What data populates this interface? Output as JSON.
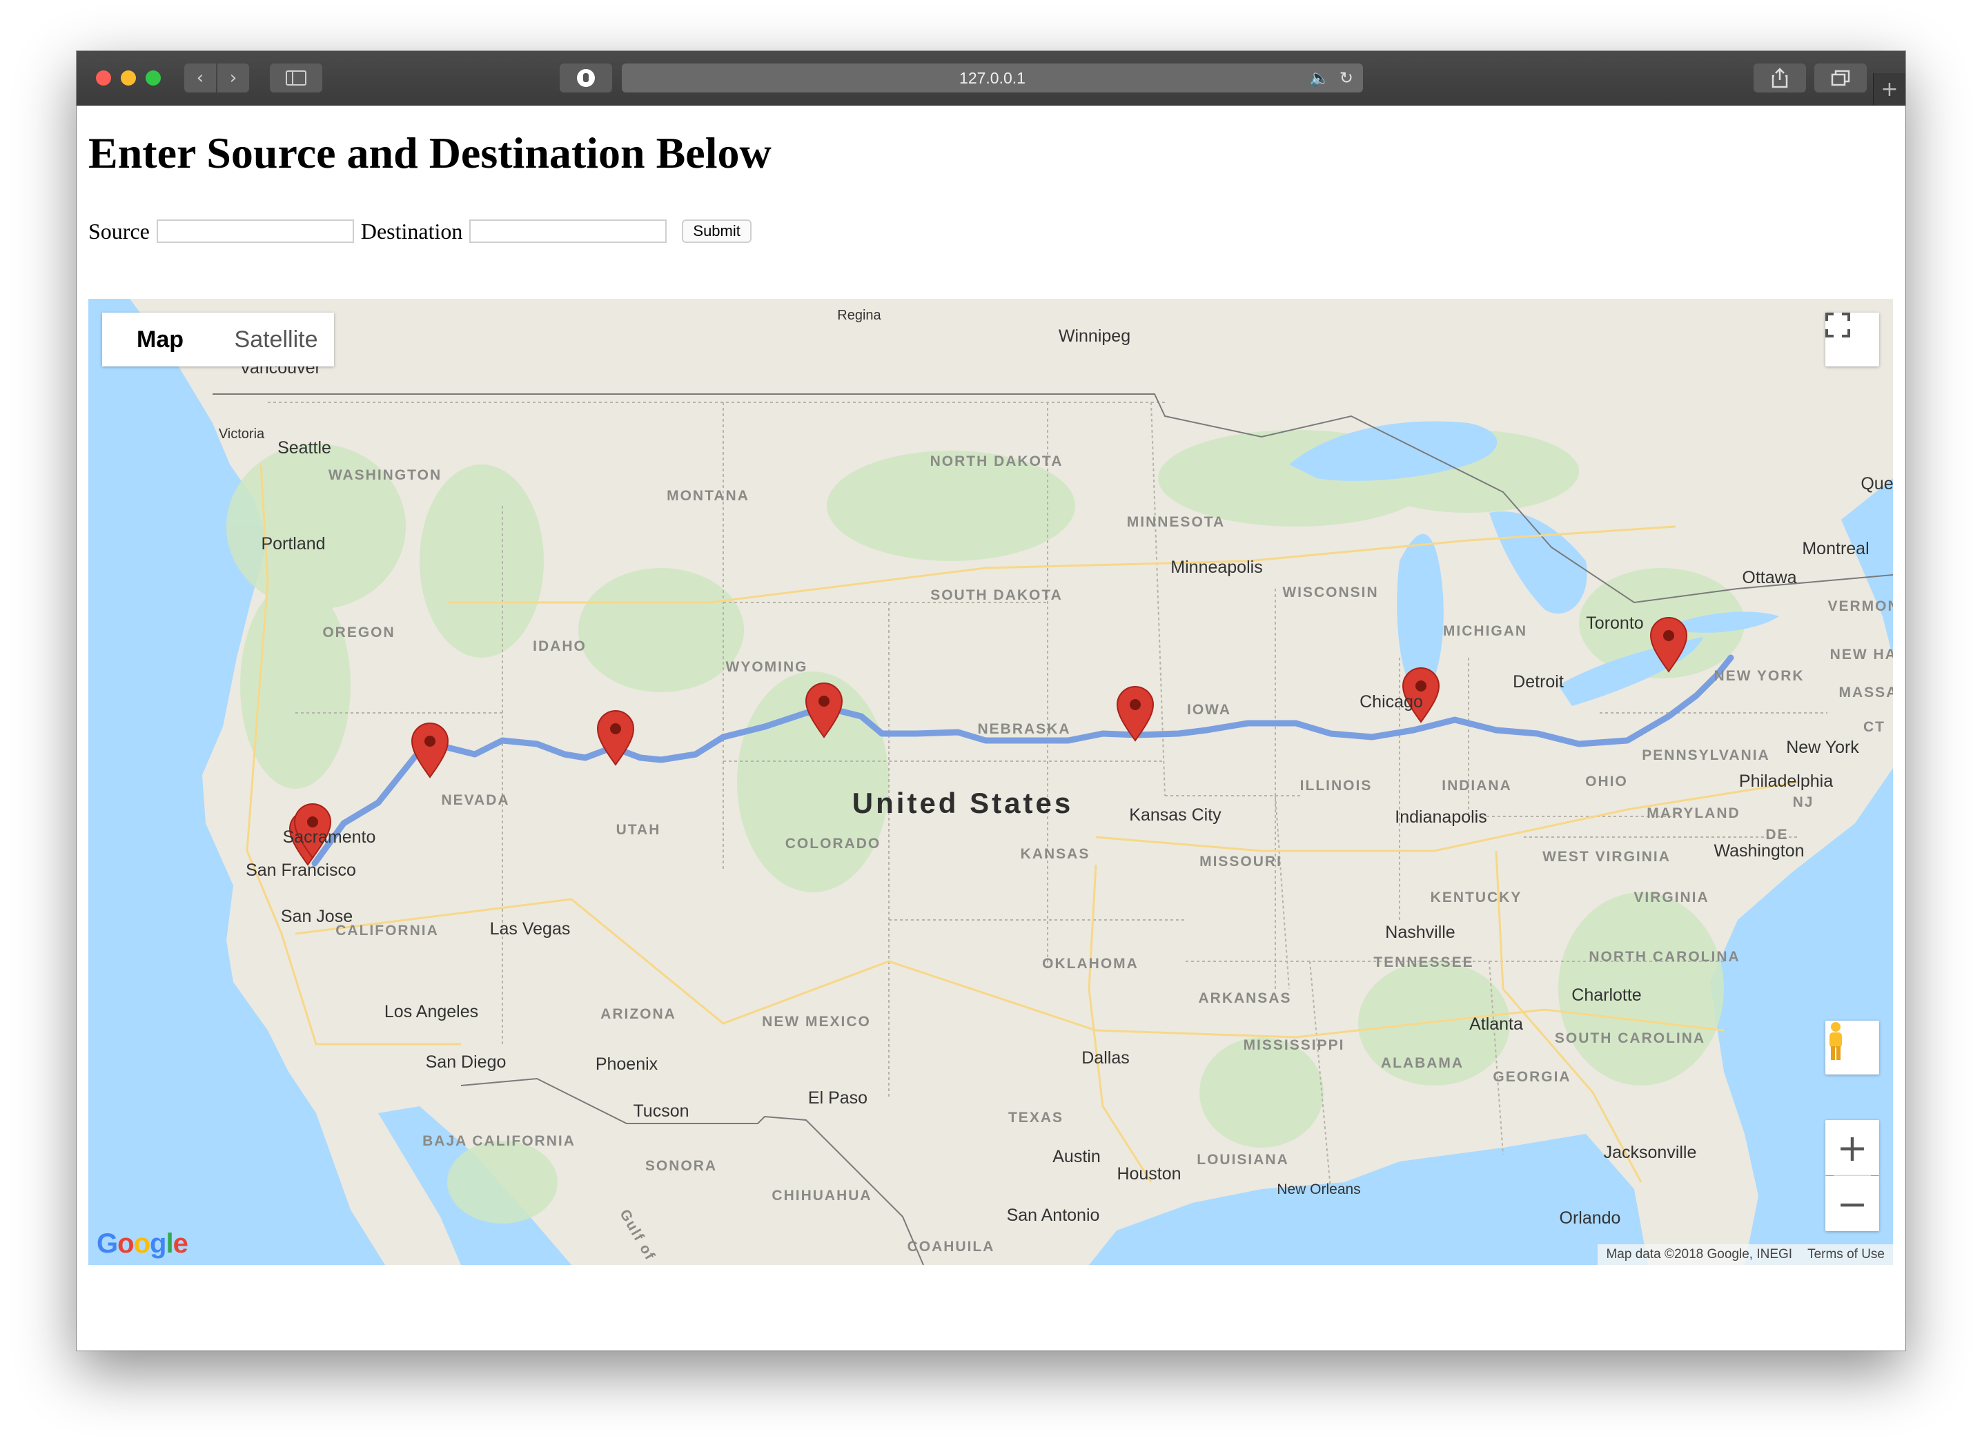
{
  "browser": {
    "url": "127.0.0.1"
  },
  "page": {
    "heading": "Enter Source and Destination Below",
    "source_label": "Source",
    "destination_label": "Destination",
    "source_value": "",
    "destination_value": "",
    "submit_label": "Submit"
  },
  "map": {
    "type_map": "Map",
    "type_satellite": "Satellite",
    "country_label": "United States",
    "attribution": "Map data ©2018 Google, INEGI",
    "terms": "Terms of Use",
    "zoom_in": "+",
    "zoom_out": "−",
    "route_color": "#7a9fe0",
    "marker_color": "#d93b30",
    "water_color": "#aadaff",
    "land_color": "#ebe9e2",
    "cities": [
      {
        "name": "Regina"
      },
      {
        "name": "Winnipeg"
      },
      {
        "name": "Vancouver"
      },
      {
        "name": "Victoria"
      },
      {
        "name": "Seattle"
      },
      {
        "name": "Portland"
      },
      {
        "name": "Sacramento"
      },
      {
        "name": "San Francisco"
      },
      {
        "name": "San Jose"
      },
      {
        "name": "Las Vegas"
      },
      {
        "name": "Los Angeles"
      },
      {
        "name": "San Diego"
      },
      {
        "name": "Phoenix"
      },
      {
        "name": "Tucson"
      },
      {
        "name": "El Paso"
      },
      {
        "name": "Dallas"
      },
      {
        "name": "Austin"
      },
      {
        "name": "Houston"
      },
      {
        "name": "San Antonio"
      },
      {
        "name": "New Orleans"
      },
      {
        "name": "Minneapolis"
      },
      {
        "name": "Kansas City"
      },
      {
        "name": "Chicago"
      },
      {
        "name": "Indianapolis"
      },
      {
        "name": "Detroit"
      },
      {
        "name": "Toronto"
      },
      {
        "name": "Ottawa"
      },
      {
        "name": "Montreal"
      },
      {
        "name": "New York"
      },
      {
        "name": "Philadelphia"
      },
      {
        "name": "Washington"
      },
      {
        "name": "Nashville"
      },
      {
        "name": "Charlotte"
      },
      {
        "name": "Atlanta"
      },
      {
        "name": "Jacksonville"
      },
      {
        "name": "Orlando"
      },
      {
        "name": "Que"
      }
    ],
    "regions": [
      {
        "name": "WASHINGTON"
      },
      {
        "name": "MONTANA"
      },
      {
        "name": "NORTH DAKOTA"
      },
      {
        "name": "MINNESOTA"
      },
      {
        "name": "OREGON"
      },
      {
        "name": "IDAHO"
      },
      {
        "name": "WYOMING"
      },
      {
        "name": "SOUTH DAKOTA"
      },
      {
        "name": "WISCONSIN"
      },
      {
        "name": "MICHIGAN"
      },
      {
        "name": "NEVADA"
      },
      {
        "name": "UTAH"
      },
      {
        "name": "COLORADO"
      },
      {
        "name": "NEBRASKA"
      },
      {
        "name": "IOWA"
      },
      {
        "name": "ILLINOIS"
      },
      {
        "name": "INDIANA"
      },
      {
        "name": "OHIO"
      },
      {
        "name": "PENNSYLVANIA"
      },
      {
        "name": "NEW YORK"
      },
      {
        "name": "CALIFORNIA"
      },
      {
        "name": "KANSAS"
      },
      {
        "name": "MISSOURI"
      },
      {
        "name": "KENTUCKY"
      },
      {
        "name": "WEST VIRGINIA"
      },
      {
        "name": "VIRGINIA"
      },
      {
        "name": "MARYLAND"
      },
      {
        "name": "ARIZONA"
      },
      {
        "name": "NEW MEXICO"
      },
      {
        "name": "OKLAHOMA"
      },
      {
        "name": "ARKANSAS"
      },
      {
        "name": "TENNESSEE"
      },
      {
        "name": "NORTH CAROLINA"
      },
      {
        "name": "SOUTH CAROLINA"
      },
      {
        "name": "MISSISSIPPI"
      },
      {
        "name": "ALABAMA"
      },
      {
        "name": "GEORGIA"
      },
      {
        "name": "TEXAS"
      },
      {
        "name": "LOUISIANA"
      },
      {
        "name": "BAJA CALIFORNIA"
      },
      {
        "name": "SONORA"
      },
      {
        "name": "CHIHUAHUA"
      },
      {
        "name": "COAHUILA"
      },
      {
        "name": "VERMONT"
      },
      {
        "name": "MASSAC"
      },
      {
        "name": "NJ"
      },
      {
        "name": "DE"
      },
      {
        "name": "CT"
      },
      {
        "name": "NEW HAMP"
      },
      {
        "name": "Gulf of"
      }
    ],
    "markers": [
      {
        "name": "San Francisco stop"
      },
      {
        "name": "Nevada stop"
      },
      {
        "name": "Utah stop"
      },
      {
        "name": "Wyoming stop"
      },
      {
        "name": "Nebraska stop"
      },
      {
        "name": "Chicago stop"
      },
      {
        "name": "Toronto stop"
      }
    ]
  }
}
